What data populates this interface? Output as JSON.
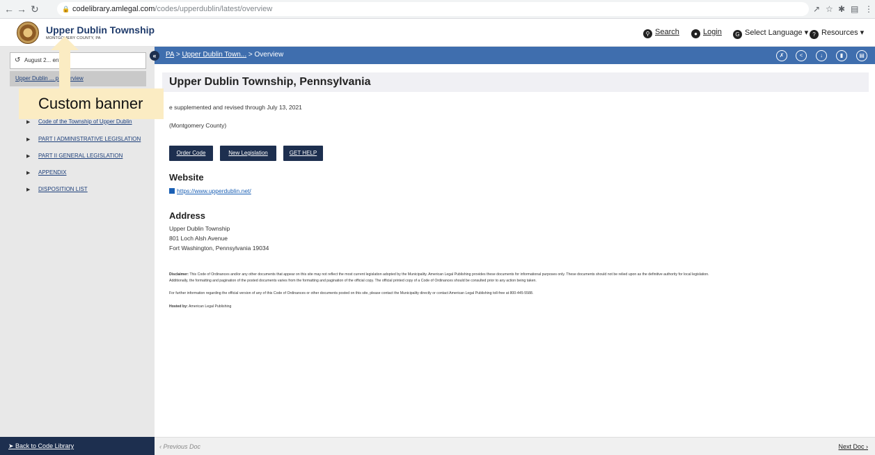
{
  "browser": {
    "url_host": "codelibrary.amlegal.com",
    "url_path": "/codes/upperdublin/latest/overview"
  },
  "header": {
    "title": "Upper Dublin Township",
    "subtitle": "MONTGOMERY COUNTY, PA",
    "search_label": "Search",
    "login_label": "Login",
    "language_label": "Select Language",
    "resources_label": "Resources"
  },
  "sidebar": {
    "date_value": "August 2...",
    "date_value_tail": "ent)",
    "overview_label": "Upper Dublin ... p Overview",
    "items": [
      {
        "label": "Code of the Township of Upper Dublin"
      },
      {
        "label": "PART I ADMINISTRATIVE LEGISLATION"
      },
      {
        "label": "PART II GENERAL LEGISLATION"
      },
      {
        "label": "APPENDIX"
      },
      {
        "label": "DISPOSITION LIST"
      }
    ]
  },
  "callout": {
    "label": "Custom banner"
  },
  "breadcrumb": {
    "state": "PA",
    "town": "Upper Dublin Town...",
    "current": "> Overview"
  },
  "main": {
    "title": "Upper Dublin Township, Pennsylvania",
    "supplement": "e supplemented and revised through July 13, 2021",
    "county": "(Montgomery County)",
    "buttons": {
      "order_code": "Order Code",
      "new_legislation": "New Legislation",
      "get_help": "GET HELP"
    },
    "website_heading": "Website",
    "website_url": "https://www.upperdublin.net/",
    "address_heading": "Address",
    "address_lines": [
      "Upper Dublin Township",
      "801 Loch Alsh Avenue",
      "Fort Washington, Pennsylvania 19034"
    ],
    "disclaimer_label": "Disclaimer:",
    "disclaimer_line1": "This Code of Ordinances and/or any other documents that appear on this site may not reflect the most current legislation adopted by the Municipality. American Legal Publishing provides these documents for informational purposes only. These documents should not be relied upon as the definitive authority for local legislation.",
    "disclaimer_line2": "Additionally, the formatting and pagination of the posted documents varies from the formatting and pagination of the official copy. The official printed copy of a Code of Ordinances should be consulted prior to any action being taken.",
    "further_info": "For further information regarding the official version of any of this Code of Ordinances or other documents posted on this site, please contact the Municipality directly or contact American Legal Publishing toll-free at 800-445-5588.",
    "hosted_label": "Hosted by:",
    "hosted_value": "American Legal Publishing"
  },
  "footer": {
    "back_label": "Back to Code Library",
    "prev_label": "Previous Doc",
    "next_label": "Next Doc"
  }
}
